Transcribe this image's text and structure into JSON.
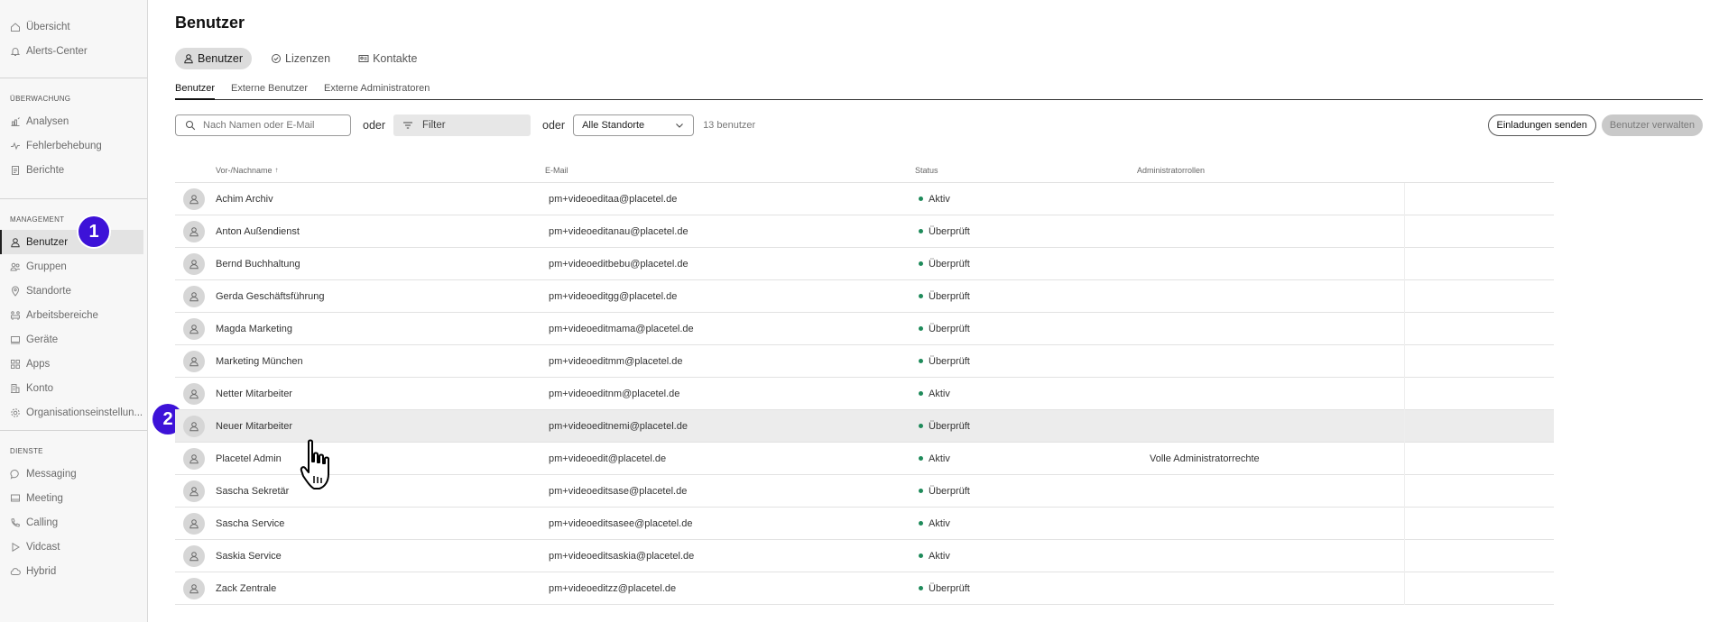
{
  "sidebar": {
    "top_items": [
      {
        "label": "Übersicht",
        "icon": "home-icon"
      },
      {
        "label": "Alerts-Center",
        "icon": "bell-icon"
      }
    ],
    "sections": [
      {
        "heading": "ÜBERWACHUNG",
        "items": [
          {
            "label": "Analysen",
            "icon": "bar-chart-icon"
          },
          {
            "label": "Fehlerbehebung",
            "icon": "pulse-icon"
          },
          {
            "label": "Berichte",
            "icon": "document-icon"
          }
        ]
      },
      {
        "heading": "MANAGEMENT",
        "items": [
          {
            "label": "Benutzer",
            "icon": "user-icon",
            "active": true
          },
          {
            "label": "Gruppen",
            "icon": "group-icon"
          },
          {
            "label": "Standorte",
            "icon": "location-pin-icon"
          },
          {
            "label": "Arbeitsbereiche",
            "icon": "workspace-icon"
          },
          {
            "label": "Geräte",
            "icon": "device-icon"
          },
          {
            "label": "Apps",
            "icon": "apps-grid-icon"
          },
          {
            "label": "Konto",
            "icon": "building-icon"
          },
          {
            "label": "Organisationseinstellun...",
            "icon": "gear-icon"
          }
        ]
      },
      {
        "heading": "DIENSTE",
        "items": [
          {
            "label": "Messaging",
            "icon": "chat-bubble-icon"
          },
          {
            "label": "Meeting",
            "icon": "meeting-icon"
          },
          {
            "label": "Calling",
            "icon": "phone-icon"
          },
          {
            "label": "Vidcast",
            "icon": "play-icon"
          },
          {
            "label": "Hybrid",
            "icon": "cloud-icon"
          }
        ]
      }
    ]
  },
  "badges": {
    "one": "1",
    "two": "2"
  },
  "page": {
    "title": "Benutzer"
  },
  "pills": [
    {
      "label": "Benutzer",
      "icon": "user-icon",
      "active": true
    },
    {
      "label": "Lizenzen",
      "icon": "check-circle-icon"
    },
    {
      "label": "Kontakte",
      "icon": "contact-card-icon"
    }
  ],
  "subtabs": [
    {
      "label": "Benutzer",
      "active": true
    },
    {
      "label": "Externe Benutzer"
    },
    {
      "label": "Externe Administratoren"
    }
  ],
  "toolbar": {
    "search_placeholder": "Nach Namen oder E-Mail",
    "or_1": "oder",
    "filter_label": "Filter",
    "or_2": "oder",
    "location_select": "Alle Standorte",
    "count": "13 benutzer",
    "invite_button": "Einladungen senden",
    "manage_button": "Benutzer verwalten"
  },
  "table": {
    "headers": {
      "name": "Vor-/Nachname",
      "sort_indicator": "↑",
      "email": "E-Mail",
      "status": "Status",
      "admin": "Administratorrollen"
    },
    "rows": [
      {
        "name": "Achim Archiv",
        "email": "pm+videoeditaa@placetel.de",
        "status": "Aktiv",
        "admin": ""
      },
      {
        "name": "Anton Außendienst",
        "email": "pm+videoeditanau@placetel.de",
        "status": "Überprüft",
        "admin": ""
      },
      {
        "name": "Bernd Buchhaltung",
        "email": "pm+videoeditbebu@placetel.de",
        "status": "Überprüft",
        "admin": ""
      },
      {
        "name": "Gerda Geschäftsführung",
        "email": "pm+videoeditgg@placetel.de",
        "status": "Überprüft",
        "admin": ""
      },
      {
        "name": "Magda Marketing",
        "email": "pm+videoeditmama@placetel.de",
        "status": "Überprüft",
        "admin": ""
      },
      {
        "name": "Marketing München",
        "email": "pm+videoeditmm@placetel.de",
        "status": "Überprüft",
        "admin": ""
      },
      {
        "name": "Netter Mitarbeiter",
        "email": "pm+videoeditnm@placetel.de",
        "status": "Aktiv",
        "admin": ""
      },
      {
        "name": "Neuer Mitarbeiter",
        "email": "pm+videoeditnemi@placetel.de",
        "status": "Überprüft",
        "admin": "",
        "hover": true
      },
      {
        "name": "Placetel Admin",
        "email": "pm+videoedit@placetel.de",
        "status": "Aktiv",
        "admin": "Volle Administratorrechte"
      },
      {
        "name": "Sascha Sekretär",
        "email": "pm+videoeditsase@placetel.de",
        "status": "Überprüft",
        "admin": ""
      },
      {
        "name": "Sascha Service",
        "email": "pm+videoeditsasee@placetel.de",
        "status": "Aktiv",
        "admin": ""
      },
      {
        "name": "Saskia Service",
        "email": "pm+videoeditsaskia@placetel.de",
        "status": "Aktiv",
        "admin": ""
      },
      {
        "name": "Zack Zentrale",
        "email": "pm+videoeditzz@placetel.de",
        "status": "Überprüft",
        "admin": ""
      }
    ]
  },
  "colors": {
    "accent_badge": "#3d12d8",
    "status_dot": "#1e8a5a",
    "hover_row": "#ececec"
  }
}
